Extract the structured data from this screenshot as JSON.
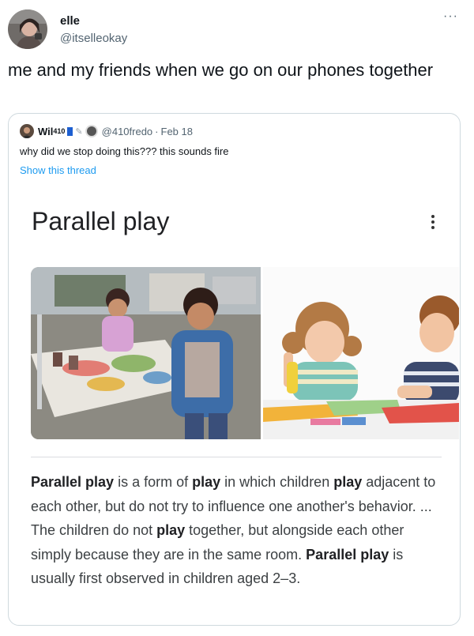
{
  "tweet": {
    "author_name": "elle",
    "author_handle": "@itselleokay",
    "more_label": "···",
    "text": "me and my friends when we go on our phones together"
  },
  "quote": {
    "author_name": "Wil",
    "author_name_suffix": "410",
    "author_handle": "@410fredo",
    "separator": "·",
    "date": "Feb 18",
    "text": "why did we stop doing this??? this sounds fire",
    "thread_link": "Show this thread"
  },
  "card": {
    "title": "Parallel play",
    "description": {
      "s1": "Parallel play",
      "s2": " is a form of ",
      "s3": "play",
      "s4": " in which children ",
      "s5": "play",
      "s6": " adjacent to each other, but do not try to influence one another's behavior. ... The children do not ",
      "s7": "play",
      "s8": " together, but alongside each other simply because they are in the same room. ",
      "s9": "Parallel play",
      "s10": " is usually first observed in children aged 2–3."
    }
  },
  "icons": {
    "avatar": "profile-photo",
    "quote_avatar": "profile-photo",
    "more": "more-icon",
    "menu": "vertical-dots-icon"
  }
}
